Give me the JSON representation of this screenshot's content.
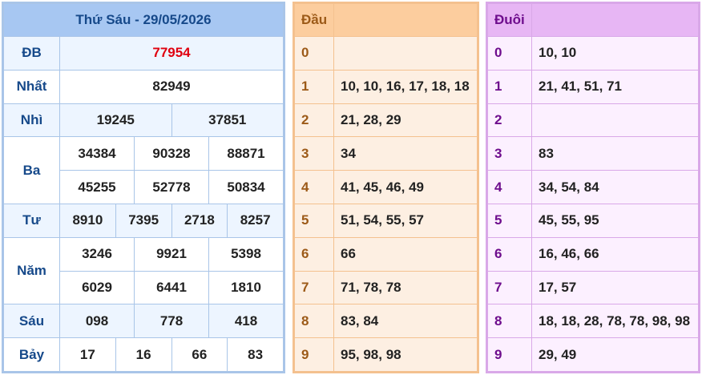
{
  "header": {
    "title": "Thứ Sáu - 29/05/2026"
  },
  "prizes": {
    "db": {
      "label": "ĐB",
      "value": "77954"
    },
    "nhat": {
      "label": "Nhất",
      "value": "82949"
    },
    "nhi": {
      "label": "Nhì",
      "values": [
        "19245",
        "37851"
      ]
    },
    "ba": {
      "label": "Ba",
      "values": [
        "34384",
        "90328",
        "88871",
        "45255",
        "52778",
        "50834"
      ]
    },
    "tu": {
      "label": "Tư",
      "values": [
        "8910",
        "7395",
        "2718",
        "8257"
      ]
    },
    "nam": {
      "label": "Năm",
      "values": [
        "3246",
        "9921",
        "5398",
        "6029",
        "6441",
        "1810"
      ]
    },
    "sau": {
      "label": "Sáu",
      "values": [
        "098",
        "778",
        "418"
      ]
    },
    "bay": {
      "label": "Bảy",
      "values": [
        "17",
        "16",
        "66",
        "83"
      ]
    }
  },
  "head_table": {
    "title": "Đầu",
    "rows": [
      {
        "key": "0",
        "value": ""
      },
      {
        "key": "1",
        "value": "10, 10, 16, 17, 18, 18"
      },
      {
        "key": "2",
        "value": "21, 28, 29"
      },
      {
        "key": "3",
        "value": "34"
      },
      {
        "key": "4",
        "value": "41, 45, 46, 49"
      },
      {
        "key": "5",
        "value": "51, 54, 55, 57"
      },
      {
        "key": "6",
        "value": "66"
      },
      {
        "key": "7",
        "value": "71, 78, 78"
      },
      {
        "key": "8",
        "value": "83, 84"
      },
      {
        "key": "9",
        "value": "95, 98, 98"
      }
    ]
  },
  "tail_table": {
    "title": "Đuôi",
    "rows": [
      {
        "key": "0",
        "value": "10, 10"
      },
      {
        "key": "1",
        "value": "21, 41, 51, 71"
      },
      {
        "key": "2",
        "value": ""
      },
      {
        "key": "3",
        "value": "83"
      },
      {
        "key": "4",
        "value": "34, 54, 84"
      },
      {
        "key": "5",
        "value": "45, 55, 95"
      },
      {
        "key": "6",
        "value": "16, 46, 66"
      },
      {
        "key": "7",
        "value": "17, 57"
      },
      {
        "key": "8",
        "value": "18, 18, 28, 78, 78, 98, 98"
      },
      {
        "key": "9",
        "value": "29, 49"
      }
    ]
  },
  "colors": {
    "main_header": "#a7c7f2",
    "label_blue": "#16498a",
    "special_red": "#e0000f",
    "head_header": "#fccd9e",
    "tail_header": "#e7b6f4"
  }
}
